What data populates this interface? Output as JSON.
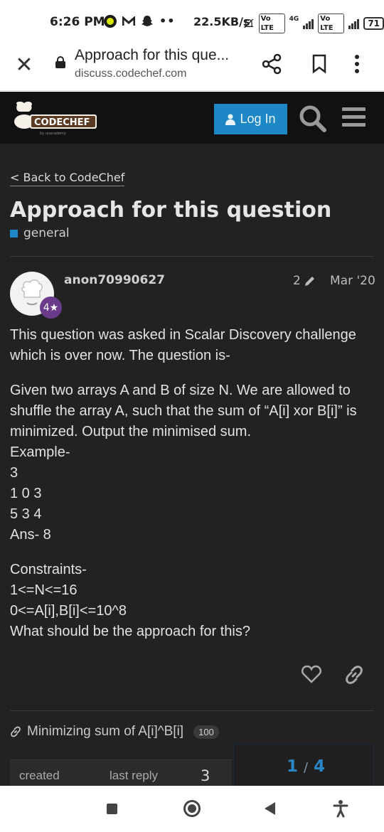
{
  "status_bar": {
    "time": "6:26 PM",
    "network_speed": "22.5KB/s",
    "lte_label": "Vo LTE",
    "network_type": "4G",
    "battery": "71",
    "icons": [
      "o-app-icon",
      "m-app-icon",
      "snapchat-icon",
      "more-notifications-icon",
      "mute-icon",
      "signal-icon",
      "battery-icon"
    ]
  },
  "browser": {
    "page_title": "Approach for this que...",
    "domain": "discuss.codechef.com",
    "icons": [
      "close-icon",
      "lock-icon",
      "share-icon",
      "bookmark-icon",
      "more-vert-icon"
    ]
  },
  "site_header": {
    "logo_text": "CODECHEF",
    "logo_subtext": "by unacademy",
    "login_label": "Log In",
    "colors": {
      "header_bg": "#111111",
      "login_bg": "#1e88c7"
    }
  },
  "topic": {
    "back_link": "< Back to CodeChef",
    "title": "Approach for this question",
    "category": "general",
    "category_color": "#1e88c7"
  },
  "post": {
    "username": "anon70990627",
    "star_rating": "4★",
    "edit_count": "2",
    "date": "Mar '20",
    "paragraph1": "This question was asked in Scalar Discovery challenge which is over now. The question is-",
    "paragraph2_lines": [
      "Given two arrays A and B of size N. We are allowed to shuffle the array A, such that the sum of “A[i] xor B[i]” is minimized. Output the minimised sum.",
      "Example-",
      "3",
      "1 0 3",
      "5 3 4",
      "Ans- 8"
    ],
    "paragraph3_lines": [
      "Constraints-",
      "1<=N<=16",
      "0<=A[i],B[i]<=10^8",
      "What should be the approach for this?"
    ]
  },
  "linked_topic": {
    "title": "Minimizing sum of A[i]^B[i]",
    "clicks": "100"
  },
  "summary": {
    "created_label": "created",
    "last_reply_label": "last reply",
    "replies": "3"
  },
  "progress": {
    "current": "1",
    "separator": "/",
    "total": "4"
  },
  "nav_bar": {
    "icons": [
      "recents-icon",
      "home-icon",
      "back-icon",
      "accessibility-icon"
    ]
  }
}
